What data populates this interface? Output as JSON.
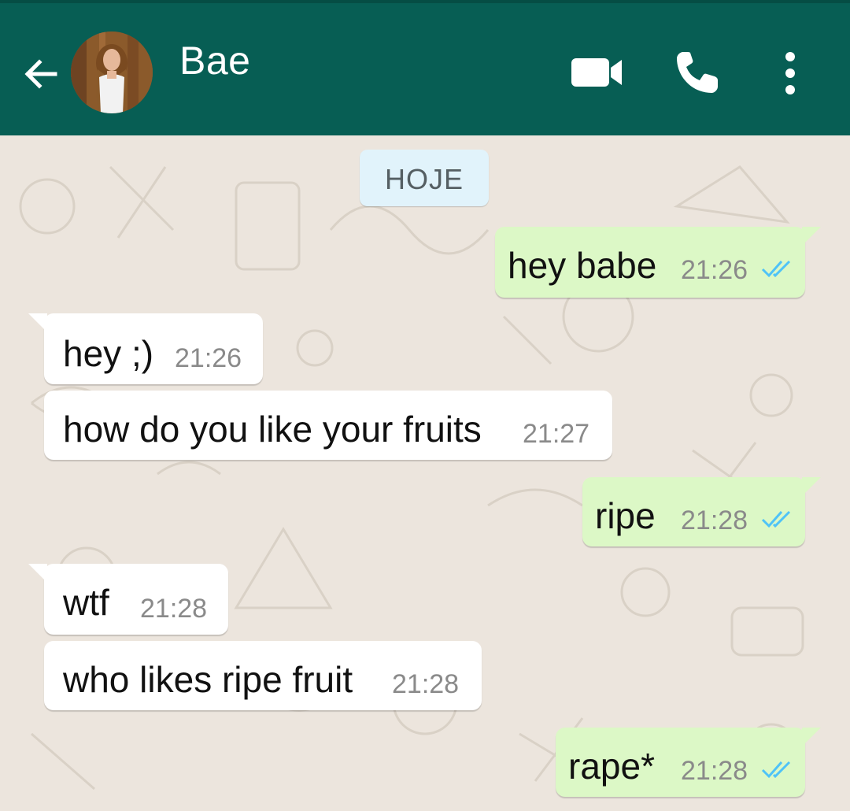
{
  "header": {
    "title": "Bae",
    "back_icon": "arrow-left-icon",
    "video_icon": "video-call-icon",
    "call_icon": "phone-icon",
    "menu_icon": "more-vertical-icon",
    "bg_color": "#075e54"
  },
  "chat": {
    "date_label": "HOJE",
    "messages": [
      {
        "direction": "outgoing",
        "text": "hey babe",
        "time": "21:26",
        "status": "read"
      },
      {
        "direction": "incoming",
        "text": "hey ;)",
        "time": "21:26"
      },
      {
        "direction": "incoming",
        "text": "how do you like your fruits",
        "time": "21:27"
      },
      {
        "direction": "outgoing",
        "text": "ripe",
        "time": "21:28",
        "status": "read"
      },
      {
        "direction": "incoming",
        "text": "wtf",
        "time": "21:28"
      },
      {
        "direction": "incoming",
        "text": "who likes ripe fruit",
        "time": "21:28"
      },
      {
        "direction": "outgoing",
        "text": "rape*",
        "time": "21:28",
        "status": "read"
      }
    ],
    "outgoing_color": "#dcf8c6",
    "incoming_color": "#ffffff",
    "read_tick_color": "#4fc3f7"
  }
}
